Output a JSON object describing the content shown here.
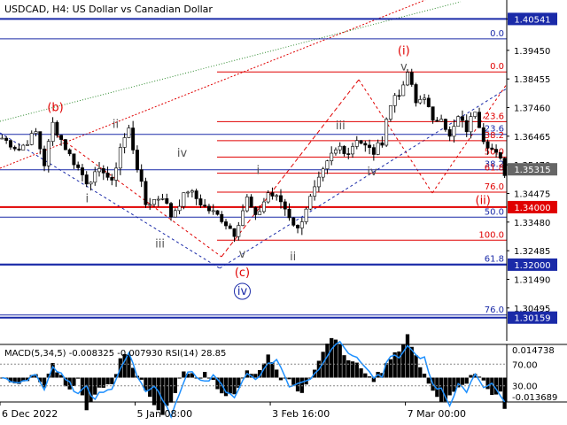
{
  "chart_data": {
    "type": "line",
    "subtype": "candlestick",
    "title": "USDCAD, H4:  US Dollar vs Canadian Dollar",
    "ylim": [
      1.2935,
      1.412
    ],
    "y_ticks": [
      "1.40541",
      "1.39450",
      "1.38455",
      "1.37460",
      "1.36465",
      "1.35470",
      "1.34475",
      "1.33480",
      "1.32485",
      "1.31490",
      "1.30495"
    ],
    "y_tick_values": [
      1.40541,
      1.3945,
      1.38455,
      1.3746,
      1.36465,
      1.3547,
      1.34475,
      1.3348,
      1.32485,
      1.3149,
      1.30495
    ],
    "x_ticks": [
      "6 Dec 2022",
      "5 Jan 08:00",
      "3 Feb 16:00",
      "7 Mar 00:00"
    ],
    "x_tick_index": [
      0,
      32,
      64,
      96
    ],
    "n_bars": 120,
    "price_series": {
      "name": "USDCAD H4",
      "anchors": [
        [
          0,
          1.364
        ],
        [
          4,
          1.36
        ],
        [
          8,
          1.366
        ],
        [
          10,
          1.355
        ],
        [
          12,
          1.369
        ],
        [
          16,
          1.358
        ],
        [
          20,
          1.349
        ],
        [
          24,
          1.353
        ],
        [
          26,
          1.348
        ],
        [
          28,
          1.361
        ],
        [
          30,
          1.367
        ],
        [
          32,
          1.354
        ],
        [
          34,
          1.341
        ],
        [
          38,
          1.344
        ],
        [
          40,
          1.337
        ],
        [
          44,
          1.346
        ],
        [
          48,
          1.34
        ],
        [
          52,
          1.336
        ],
        [
          55,
          1.331
        ],
        [
          58,
          1.343
        ],
        [
          60,
          1.336
        ],
        [
          63,
          1.345
        ],
        [
          66,
          1.342
        ],
        [
          70,
          1.332
        ],
        [
          72,
          1.34
        ],
        [
          74,
          1.346
        ],
        [
          76,
          1.352
        ],
        [
          78,
          1.358
        ],
        [
          80,
          1.361
        ],
        [
          82,
          1.359
        ],
        [
          84,
          1.364
        ],
        [
          86,
          1.361
        ],
        [
          88,
          1.359
        ],
        [
          90,
          1.363
        ],
        [
          91,
          1.371
        ],
        [
          93,
          1.379
        ],
        [
          95,
          1.381
        ],
        [
          96,
          1.387
        ],
        [
          98,
          1.376
        ],
        [
          100,
          1.379
        ],
        [
          102,
          1.369
        ],
        [
          104,
          1.372
        ],
        [
          106,
          1.364
        ],
        [
          108,
          1.371
        ],
        [
          110,
          1.367
        ],
        [
          112,
          1.374
        ],
        [
          114,
          1.364
        ],
        [
          116,
          1.36
        ],
        [
          118,
          1.356
        ],
        [
          119,
          1.352
        ]
      ]
    },
    "price_labels": [
      {
        "text": "1.40541",
        "value": 1.40541,
        "color": "#1a2aa8",
        "style": "box"
      },
      {
        "text": "1.35315",
        "value": 1.35315,
        "color": "#666666",
        "style": "box-gray"
      },
      {
        "text": "1.34000",
        "value": 1.34,
        "color": "#e00000",
        "style": "box"
      },
      {
        "text": "1.32000",
        "value": 1.32,
        "color": "#1a2aa8",
        "style": "box"
      },
      {
        "text": "1.30159",
        "value": 1.30159,
        "color": "#1a2aa8",
        "style": "box"
      }
    ],
    "horizontal_levels": [
      {
        "value": 1.40541,
        "color": "#1a2aa8",
        "width": 2
      },
      {
        "value": 1.34,
        "color": "#e00000",
        "width": 2
      },
      {
        "value": 1.32,
        "color": "#1a2aa8",
        "width": 2
      },
      {
        "value": 1.30159,
        "color": "#1a2aa8",
        "width": 2
      }
    ],
    "fib_blue": {
      "color": "#1a2aa8",
      "levels": [
        {
          "label": "0.0",
          "value": 1.3985
        },
        {
          "label": "23.6",
          "value": 1.3653
        },
        {
          "label": "38.2",
          "value": 1.353
        },
        {
          "label": "50.0",
          "value": 1.3365
        },
        {
          "label": "61.8",
          "value": 1.3202
        },
        {
          "label": "76.0",
          "value": 1.3025
        }
      ]
    },
    "fib_red": {
      "color": "#e00000",
      "levels": [
        {
          "label": "0.0",
          "value": 1.387
        },
        {
          "label": "23.6",
          "value": 1.3697
        },
        {
          "label": "38.2",
          "value": 1.3631
        },
        {
          "label": "50.0",
          "value": 1.3574
        },
        {
          "label": "61.8",
          "value": 1.3518
        },
        {
          "label": "76.0",
          "value": 1.3452
        },
        {
          "label": "100.0",
          "value": 1.3285
        }
      ]
    },
    "wave_labels": [
      {
        "text": "(b)",
        "bar": 17,
        "value": 1.3733,
        "color": "#e00000"
      },
      {
        "text": "ii",
        "bar": 36,
        "value": 1.3675,
        "color": "#555555"
      },
      {
        "text": "iv",
        "bar": 57,
        "value": 1.3575,
        "color": "#555555"
      },
      {
        "text": "i",
        "bar": 27,
        "value": 1.3417,
        "color": "#555555"
      },
      {
        "text": "iii",
        "bar": 50,
        "value": 1.326,
        "color": "#555555"
      },
      {
        "text": "v",
        "bar": 76,
        "value": 1.3225,
        "color": "#555555"
      },
      {
        "text": "(c)",
        "bar": 76,
        "value": 1.316,
        "color": "#e00000"
      },
      {
        "text": "iv",
        "bar": 76,
        "value": 1.3095,
        "color": "#1a2aa8",
        "circled": true
      },
      {
        "text": "ii",
        "bar": 92,
        "value": 1.3215,
        "color": "#555555"
      },
      {
        "text": "i",
        "bar": 81,
        "value": 1.3515,
        "color": "#555555"
      },
      {
        "text": "iii",
        "bar": 107,
        "value": 1.367,
        "color": "#555555"
      },
      {
        "text": "iv",
        "bar": 117,
        "value": 1.351,
        "color": "#555555"
      },
      {
        "text": "v",
        "bar": 127,
        "value": 1.3875,
        "color": "#555555"
      },
      {
        "text": "(i)",
        "bar": 127,
        "value": 1.393,
        "color": "#e00000"
      },
      {
        "text": "(ii)",
        "bar": 152,
        "value": 1.341,
        "color": "#e00000"
      }
    ],
    "macd": {
      "title": "MACD(5,34,5) -0.008325 -0.007930 RSI(14) 28.85",
      "y_ticks": [
        "0.014738",
        "70.00",
        "30.00",
        "-0.013689"
      ],
      "y_tick_values": [
        0.014738,
        70,
        30,
        -0.013689
      ],
      "rsi_ticks": [
        70,
        30
      ]
    }
  }
}
